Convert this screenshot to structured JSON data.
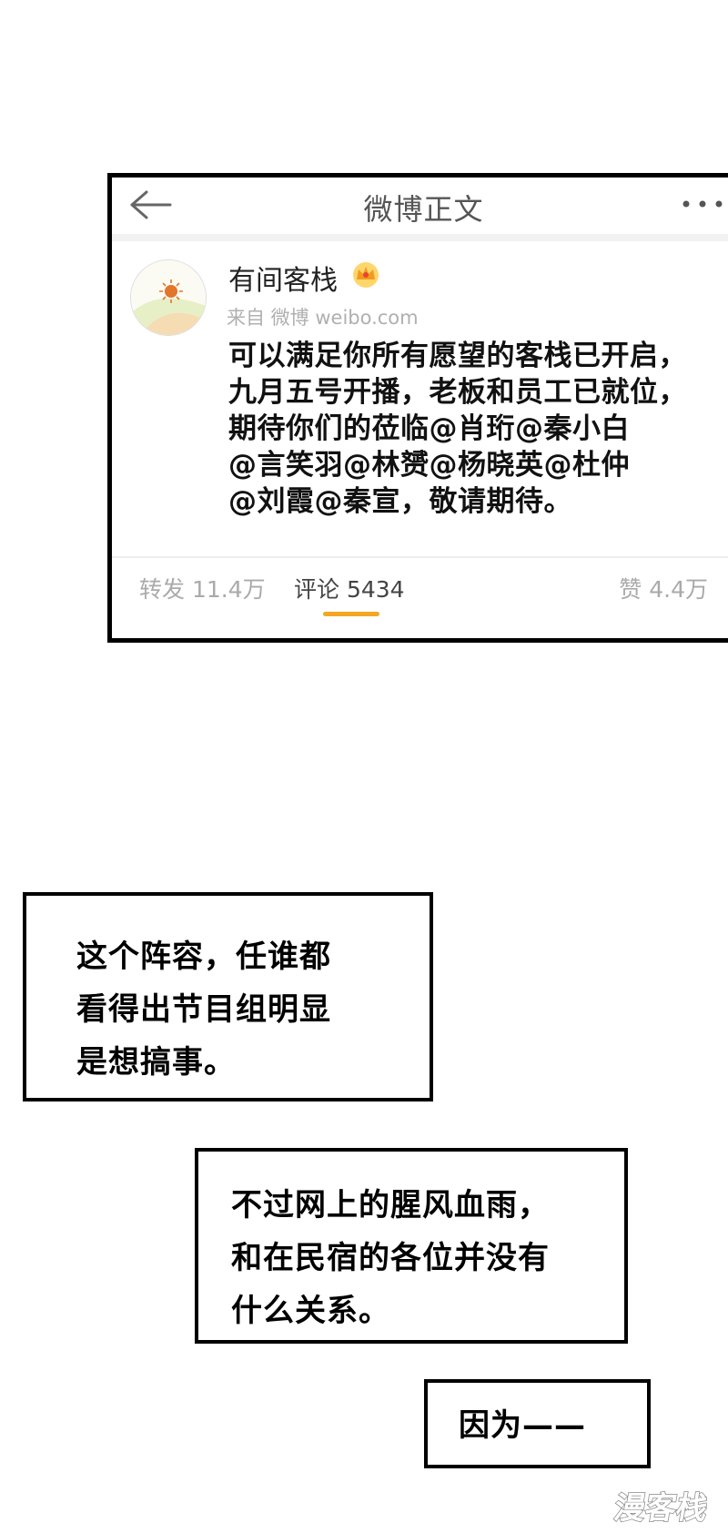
{
  "weibo": {
    "nav": {
      "title": "微博正文",
      "back_icon": "arrow-left-icon",
      "more_icon": "more-dots-icon"
    },
    "post": {
      "username": "有间客栈",
      "badge_icon": "crown-badge-icon",
      "source": "来自 微博 weibo.com",
      "lines": [
        "可以满足你所有愿望的客栈已开启，",
        "九月五号开播，老板和员工已就位，",
        "期待你们的莅临@肖珩@秦小白",
        "@言笑羽@林赟@杨晓英@杜仲",
        "@刘霞@秦宣，敬请期待。"
      ]
    },
    "actions": {
      "repost": "转发 11.4万",
      "comment": "评论 5434",
      "like": "赞 4.4万",
      "active_tab": "comment",
      "accent_color": "#f5a623"
    }
  },
  "captions": [
    {
      "lines": [
        "这个阵容，任谁都",
        "看得出节目组明显",
        "是想搞事。"
      ]
    },
    {
      "lines": [
        "不过网上的腥风血雨，",
        "和在民宿的各位并没有",
        "什么关系。"
      ]
    },
    {
      "lines": [
        "因为——"
      ]
    }
  ],
  "watermark": {
    "text": "漫客栈"
  }
}
